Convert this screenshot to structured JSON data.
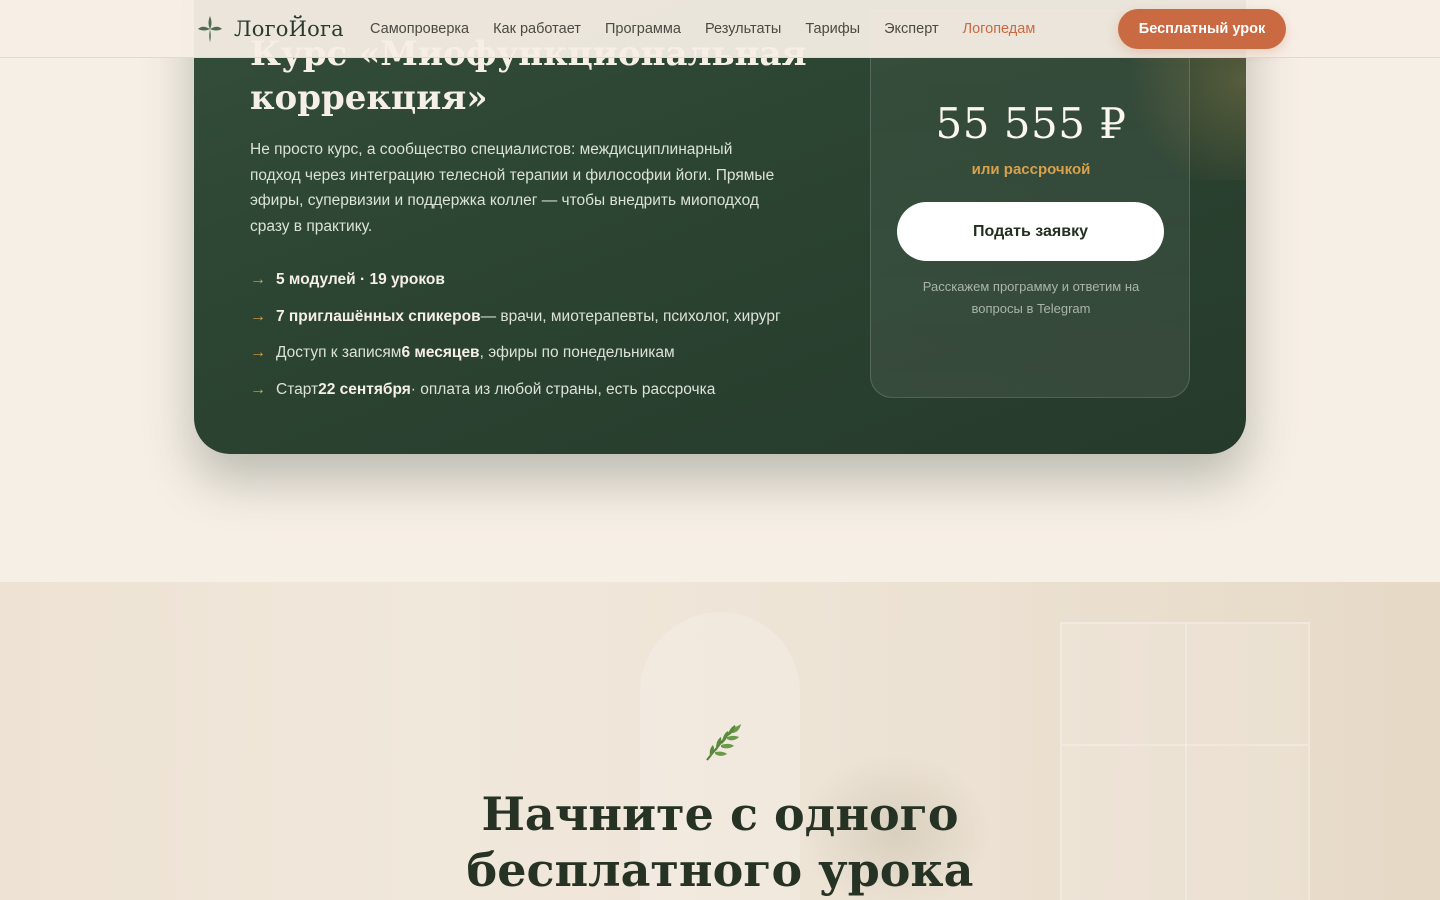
{
  "nav": {
    "logo_text": "ЛогоЙога",
    "links": [
      {
        "label": "Самопроверка"
      },
      {
        "label": "Как работает"
      },
      {
        "label": "Программа"
      },
      {
        "label": "Результаты"
      },
      {
        "label": "Тарифы"
      },
      {
        "label": "Эксперт"
      },
      {
        "label": "Логопедам"
      }
    ],
    "cta_label": "Бесплатный урок",
    "accent_color": "#c96a43"
  },
  "course": {
    "title": "Курс «Миофункциональная коррекция»",
    "description": "Не просто курс, а сообщество специалистов: междисциплинарный подход через интеграцию телесной терапии и философии йоги. Прямые эфиры, супервизии и поддержка коллег — чтобы внедрить миоподход сразу в практику.",
    "arrow_icon": "→",
    "features": [
      {
        "bold": "5 модулей · 19 уроков",
        "after": "",
        "before": ""
      },
      {
        "bold": "7 приглашённых спикеров",
        "after": " — врачи, миотерапевты, психолог, хирург",
        "before": ""
      },
      {
        "before": "Доступ к записям ",
        "bold": "6 месяцев",
        "after": ", эфиры по понедельникам"
      },
      {
        "before": "Старт ",
        "bold": "22 сентября",
        "after": " · оплата из любой страны, есть рассрочка"
      }
    ],
    "price": "55 555 ₽",
    "price_note": "или рассрочкой",
    "apply_label": "Подать заявку",
    "apply_note": "Расскажем программу и ответим на вопросы в Telegram",
    "card_color": "#2c4432"
  },
  "free_lesson": {
    "icon": "leaf-icon",
    "title": "Начните с одного бесплатного урока"
  }
}
